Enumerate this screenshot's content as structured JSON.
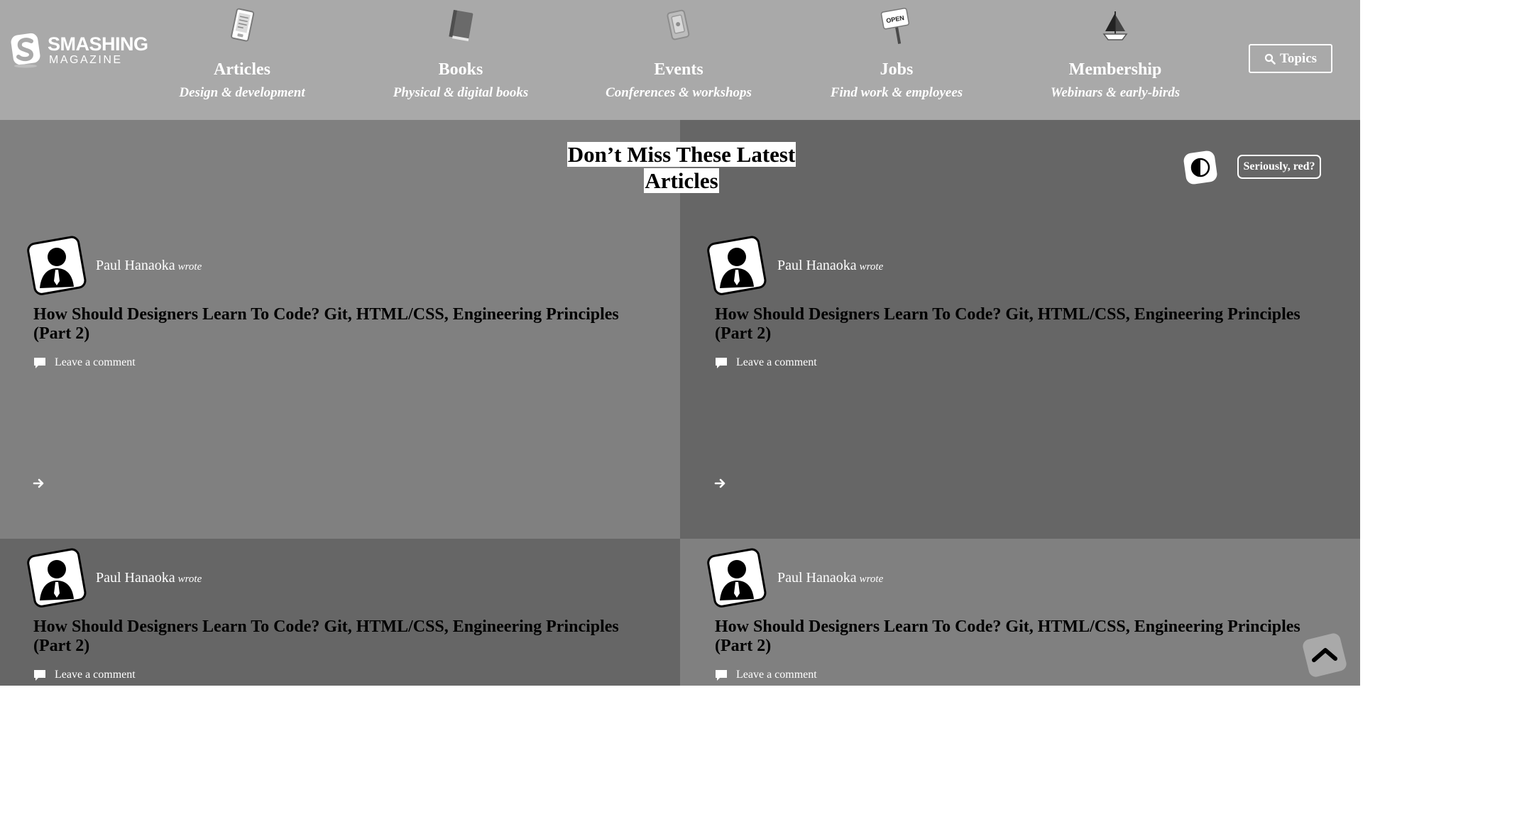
{
  "header": {
    "logo": {
      "word": "SMASHING",
      "sub": "MAGAZINE"
    },
    "nav": [
      {
        "title": "Articles",
        "subtitle": "Design & development",
        "icon": "ereader-icon"
      },
      {
        "title": "Books",
        "subtitle": "Physical & digital books",
        "icon": "book-icon"
      },
      {
        "title": "Events",
        "subtitle": "Conferences & workshops",
        "icon": "ticket-icon"
      },
      {
        "title": "Jobs",
        "subtitle": "Find work & employees",
        "icon": "open-sign-icon",
        "icon_text": "OPEN"
      },
      {
        "title": "Membership",
        "subtitle": "Webinars & early-birds",
        "icon": "boat-icon"
      }
    ],
    "topics_label": "Topics"
  },
  "section": {
    "title_line1": "Don’t Miss These Latest",
    "title_line2": "Articles",
    "contrast_icon": "contrast-icon",
    "red_button": "Seriously, red?"
  },
  "articles": [
    {
      "author": "Paul Hanaoka",
      "wrote": "wrote",
      "title": "How Should Designers Learn To Code? Git, HTML/CSS, Engineering Principles (Part 2)",
      "comment": "Leave a comment"
    },
    {
      "author": "Paul Hanaoka",
      "wrote": "wrote",
      "title": "How Should Designers Learn To Code? Git, HTML/CSS, Engineering Principles (Part 2)",
      "comment": "Leave a comment"
    },
    {
      "author": "Paul Hanaoka",
      "wrote": "wrote",
      "title": "How Should Designers Learn To Code? Git, HTML/CSS, Engineering Principles (Part 2)",
      "comment": "Leave a comment"
    },
    {
      "author": "Paul Hanaoka",
      "wrote": "wrote",
      "title": "How Should Designers Learn To Code? Git, HTML/CSS, Engineering Principles (Part 2)",
      "comment": "Leave a comment"
    }
  ],
  "colors": {
    "header_bg": "#a9a9a9",
    "card_light": "#808080",
    "card_dark": "#666666",
    "text_light": "#ffffff",
    "text_dark": "#000000"
  }
}
